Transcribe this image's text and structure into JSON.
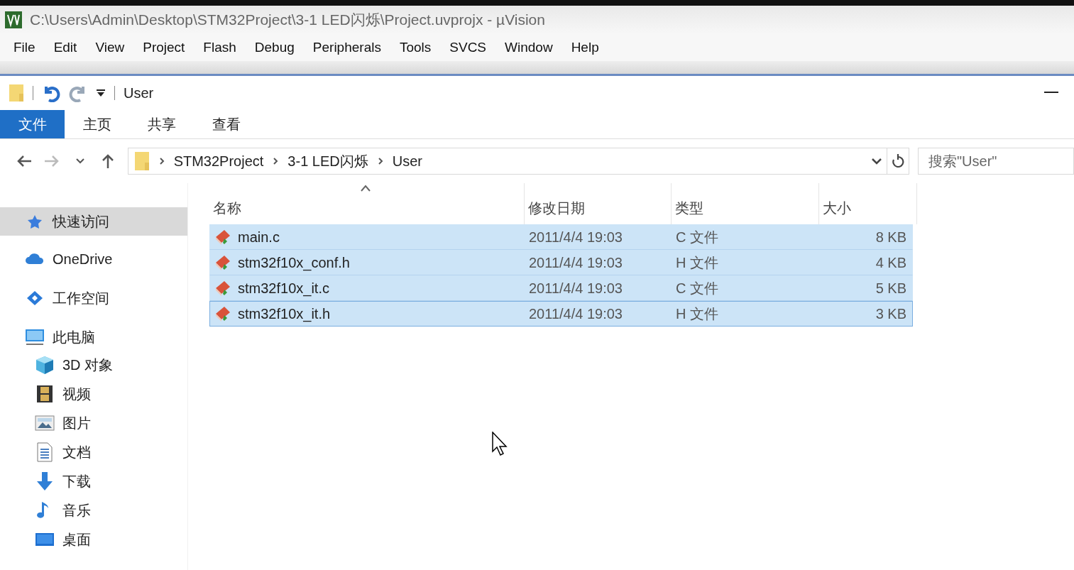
{
  "window": {
    "title": "C:\\Users\\Admin\\Desktop\\STM32Project\\3-1 LED闪烁\\Project.uvprojx - µVision"
  },
  "menu": [
    "File",
    "Edit",
    "View",
    "Project",
    "Flash",
    "Debug",
    "Peripherals",
    "Tools",
    "SVCS",
    "Window",
    "Help"
  ],
  "explorer": {
    "title": "User",
    "ribbon_tabs": [
      {
        "label": "文件",
        "selected": true
      },
      {
        "label": "主页",
        "selected": false
      },
      {
        "label": "共享",
        "selected": false
      },
      {
        "label": "查看",
        "selected": false
      }
    ],
    "breadcrumb": [
      "STM32Project",
      "3-1 LED闪烁",
      "User"
    ],
    "search": {
      "placeholder": "搜索\"User\""
    },
    "sidebar": [
      {
        "label": "快速访问",
        "selected": true
      },
      {
        "label": "OneDrive",
        "selected": false
      },
      {
        "label": "工作空间",
        "selected": false
      },
      {
        "label": "此电脑",
        "selected": false,
        "children": [
          {
            "label": "3D 对象",
            "selected": false
          },
          {
            "label": "视频",
            "selected": false
          },
          {
            "label": "图片",
            "selected": false
          },
          {
            "label": "文档",
            "selected": false
          },
          {
            "label": "下载",
            "selected": false
          },
          {
            "label": "音乐",
            "selected": false
          },
          {
            "label": "桌面",
            "selected": false
          }
        ]
      }
    ],
    "columns": [
      "名称",
      "修改日期",
      "类型",
      "大小"
    ],
    "rows": [
      {
        "name": "main.c",
        "date": "2011/4/4 19:03",
        "type": "C 文件",
        "size": "8 KB",
        "selected": true,
        "focused": false
      },
      {
        "name": "stm32f10x_conf.h",
        "date": "2011/4/4 19:03",
        "type": "H 文件",
        "size": "4 KB",
        "selected": true,
        "focused": false
      },
      {
        "name": "stm32f10x_it.c",
        "date": "2011/4/4 19:03",
        "type": "C 文件",
        "size": "5 KB",
        "selected": true,
        "focused": false
      },
      {
        "name": "stm32f10x_it.h",
        "date": "2011/4/4 19:03",
        "type": "H 文件",
        "size": "3 KB",
        "selected": true,
        "focused": true
      }
    ]
  }
}
